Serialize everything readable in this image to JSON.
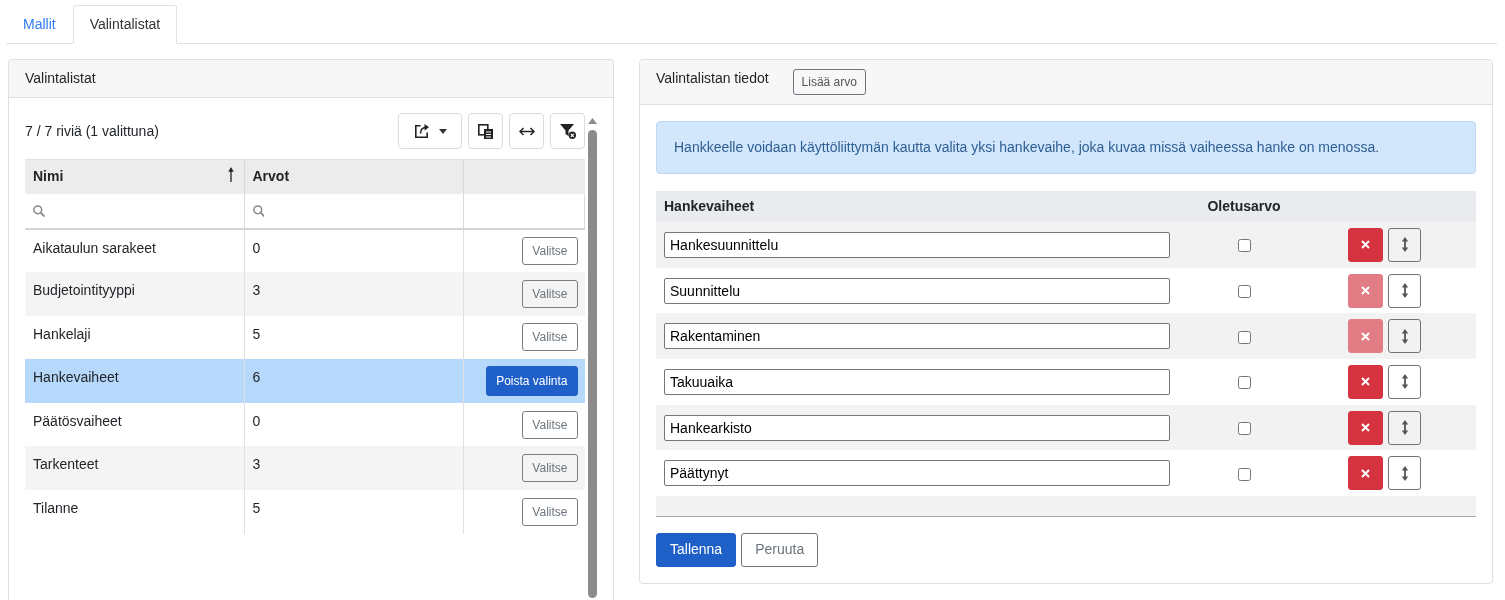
{
  "tabs": [
    {
      "label": "Mallit",
      "selected": false
    },
    {
      "label": "Valintalistat",
      "selected": true
    }
  ],
  "lists_panel": {
    "title": "Valintalistat",
    "row_count": "7 / 7 riviä (1 valittuna)",
    "table": {
      "columns": [
        {
          "label": "Nimi",
          "sorted": true
        },
        {
          "label": "Arvot",
          "sorted": false
        }
      ],
      "rows": [
        {
          "name": "Aikataulun sarakeet",
          "count": "0",
          "selected": false,
          "action": "Valitse"
        },
        {
          "name": "Budjetointityyppi",
          "count": "3",
          "selected": false,
          "action": "Valitse"
        },
        {
          "name": "Hankelaji",
          "count": "5",
          "selected": false,
          "action": "Valitse"
        },
        {
          "name": "Hankevaiheet",
          "count": "6",
          "selected": true,
          "action": "Poista valinta"
        },
        {
          "name": "Päätösvaiheet",
          "count": "0",
          "selected": false,
          "action": "Valitse"
        },
        {
          "name": "Tarkenteet",
          "count": "3",
          "selected": false,
          "action": "Valitse"
        },
        {
          "name": "Tilanne",
          "count": "5",
          "selected": false,
          "action": "Valitse"
        }
      ]
    }
  },
  "details_panel": {
    "title": "Valintalistan tiedot",
    "add_button": "Lisää arvo",
    "info": "Hankkeelle voidaan käyttöliittymän kautta valita yksi hankevaihe, joka kuvaa missä vaiheessa hanke on menossa.",
    "table": {
      "columns": [
        {
          "label": "Hankevaiheet"
        },
        {
          "label": "Oletusarvo"
        }
      ],
      "rows": [
        {
          "value": "Hankesuunnittelu",
          "default": false,
          "delete_disabled": false
        },
        {
          "value": "Suunnittelu",
          "default": false,
          "delete_disabled": true
        },
        {
          "value": "Rakentaminen",
          "default": false,
          "delete_disabled": true
        },
        {
          "value": "Takuuaika",
          "default": false,
          "delete_disabled": false
        },
        {
          "value": "Hankearkisto",
          "default": false,
          "delete_disabled": false
        },
        {
          "value": "Päättynyt",
          "default": false,
          "delete_disabled": false
        }
      ]
    },
    "buttons": [
      {
        "label": "Tallenna",
        "kind": "save"
      },
      {
        "label": "Peruuta",
        "kind": "cancel"
      }
    ]
  }
}
